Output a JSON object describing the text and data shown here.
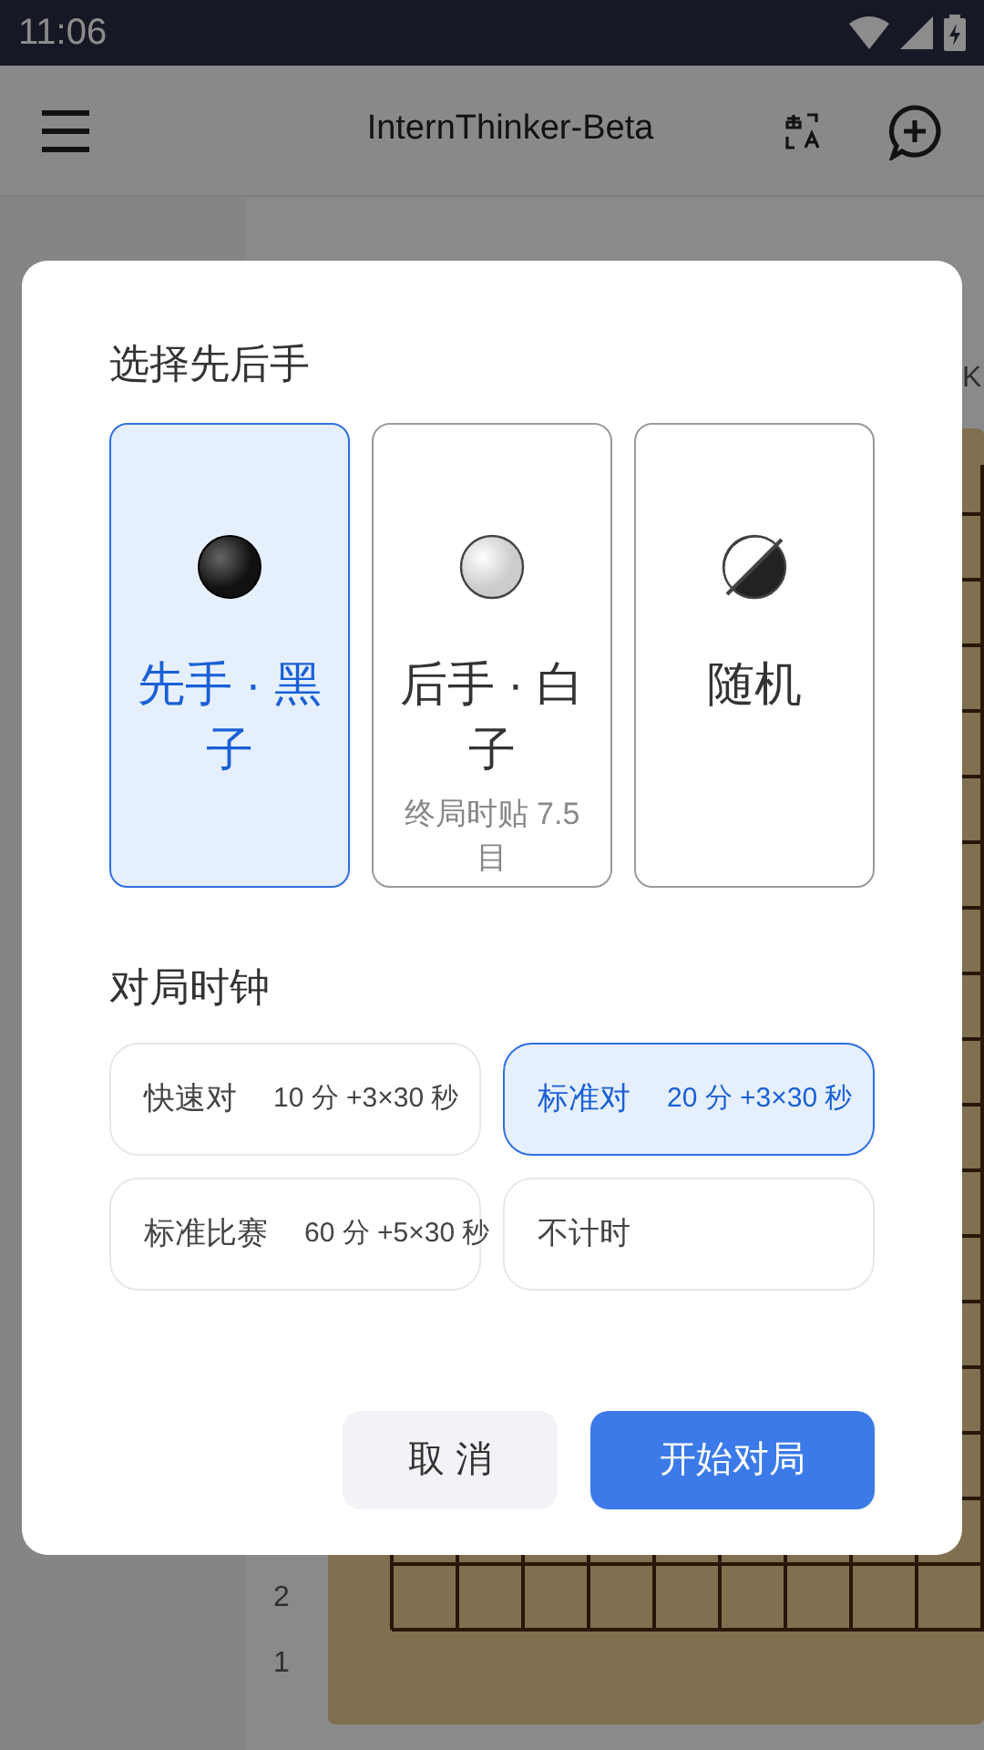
{
  "status_bar": {
    "time": "11:06"
  },
  "app_bar": {
    "title": "InternThinker-Beta"
  },
  "board": {
    "column_labels": [
      "K"
    ],
    "row_labels": [
      "2",
      "1"
    ]
  },
  "dialog": {
    "title": "选择先后手",
    "sides": [
      {
        "kind": "black",
        "label": "先手 · 黑子",
        "selected": true
      },
      {
        "kind": "white",
        "label": "后手 · 白子",
        "note": "终局时贴 7.5 目",
        "selected": false
      },
      {
        "kind": "random",
        "label": "随机",
        "selected": false
      }
    ],
    "clock_title": "对局时钟",
    "clocks": [
      {
        "label": "快速对",
        "time": "10 分 +3×30 秒",
        "selected": false
      },
      {
        "label": "标准对",
        "time": "20 分 +3×30 秒",
        "selected": true
      },
      {
        "label": "标准比赛",
        "time": "60 分 +5×30 秒",
        "selected": false
      },
      {
        "label": "不计时",
        "selected": false
      }
    ],
    "buttons": [
      {
        "kind": "cancel",
        "label": "取 消"
      },
      {
        "kind": "start",
        "label": "开始对局"
      }
    ]
  }
}
